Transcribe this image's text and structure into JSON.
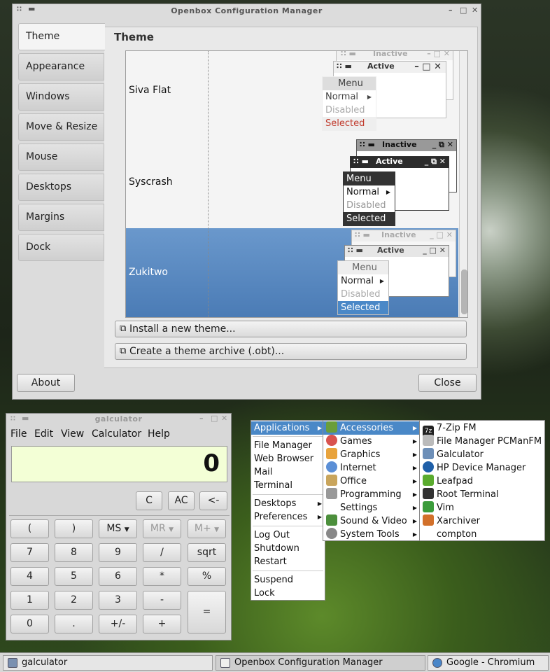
{
  "obconf": {
    "title": "Openbox Configuration Manager",
    "section_title": "Theme",
    "tabs": [
      "Theme",
      "Appearance",
      "Windows",
      "Move & Resize",
      "Mouse",
      "Desktops",
      "Margins",
      "Dock"
    ],
    "themes": [
      {
        "name": "Siva Flat"
      },
      {
        "name": "Syscrash"
      },
      {
        "name": "Zukitwo"
      }
    ],
    "preview": {
      "inactive": "Inactive",
      "active": "Active",
      "menu": "Menu",
      "normal": "Normal",
      "disabled": "Disabled",
      "selected": "Selected"
    },
    "install_button": "Install a new theme...",
    "archive_button": "Create a theme archive (.obt)...",
    "about_button": "About",
    "close_button": "Close"
  },
  "galculator": {
    "title": "galculator",
    "menu": [
      "File",
      "Edit",
      "View",
      "Calculator",
      "Help"
    ],
    "display": "0",
    "top_keys": [
      "C",
      "AC",
      "<-"
    ],
    "rows": [
      [
        "(",
        ")",
        "MS",
        "MR",
        "M+"
      ],
      [
        "7",
        "8",
        "9",
        "/",
        "sqrt"
      ],
      [
        "4",
        "5",
        "6",
        "*",
        "%"
      ],
      [
        "1",
        "2",
        "3",
        "-"
      ],
      [
        "0",
        ".",
        "+/-",
        "+"
      ]
    ],
    "equals": "="
  },
  "root_menu": {
    "items": [
      "Applications",
      "File Manager",
      "Web Browser",
      "Mail",
      "Terminal",
      "Desktops",
      "Preferences",
      "Log Out",
      "Shutdown",
      "Restart",
      "Suspend",
      "Lock"
    ]
  },
  "apps_menu": {
    "items": [
      "Accessories",
      "Games",
      "Graphics",
      "Internet",
      "Office",
      "Programming",
      "Settings",
      "Sound & Video",
      "System Tools"
    ]
  },
  "accessories_menu": {
    "items": [
      "7-Zip FM",
      "File Manager PCManFM",
      "Galculator",
      "HP Device Manager",
      "Leafpad",
      "Root Terminal",
      "Vim",
      "Xarchiver",
      "compton"
    ]
  },
  "taskbar": {
    "tasks": [
      "galculator",
      "Openbox Configuration Manager",
      "Google - Chromium"
    ]
  },
  "colors": {
    "selection": "#4a88c7",
    "error_red": "#c0392b",
    "display_bg": "#f3ffd6"
  }
}
